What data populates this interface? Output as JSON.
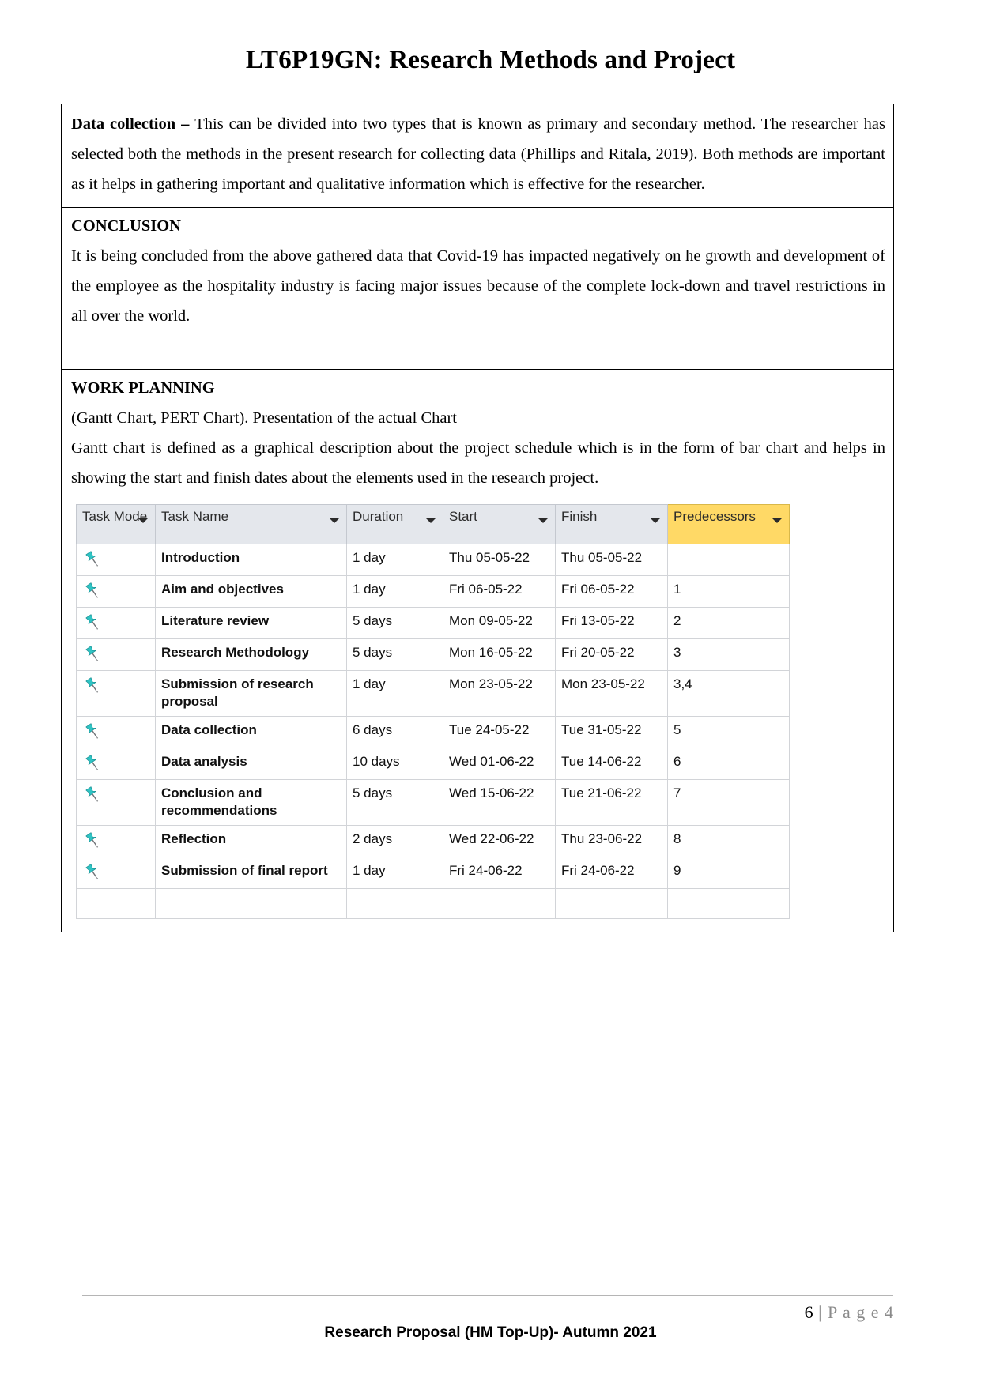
{
  "document": {
    "title": "LT6P19GN: Research Methods and Project"
  },
  "sections": {
    "data_collection": {
      "label": "Data collection – ",
      "body": "This can be divided into two types that is known as primary and secondary method. The researcher has selected both the methods in the present research for collecting data (Phillips and Ritala, 2019). Both methods are important as it helps in gathering important and qualitative information which is effective for the researcher."
    },
    "conclusion": {
      "heading": "CONCLUSION",
      "body": "It is being concluded from the above gathered data that Covid-19 has impacted negatively on he growth and development of the employee as the hospitality industry is facing major issues because of the complete lock-down and travel restrictions in all over the world."
    },
    "work_planning": {
      "heading": "WORK PLANNING",
      "line1": "(Gantt Chart, PERT Chart). Presentation of the actual Chart",
      "line2": "Gantt chart is defined as a graphical description about the project schedule which is in the form of bar chart and helps in showing the start and finish dates about the elements used in the research project."
    }
  },
  "gantt": {
    "columns": [
      {
        "key": "mode",
        "label": "Task Mode",
        "highlight": false,
        "filter": true
      },
      {
        "key": "name",
        "label": "Task Name",
        "highlight": false,
        "filter": true
      },
      {
        "key": "dur",
        "label": "Duration",
        "highlight": false,
        "filter": true
      },
      {
        "key": "start",
        "label": "Start",
        "highlight": false,
        "filter": true
      },
      {
        "key": "fin",
        "label": "Finish",
        "highlight": false,
        "filter": true
      },
      {
        "key": "pred",
        "label": "Predecessors",
        "highlight": true,
        "filter": true
      }
    ],
    "header_highlight_color": "#ffd966",
    "header_bg_color": "#e4e7ec",
    "selection_color": "#dce6f1",
    "pin_color": "#2fc4c4",
    "rows": [
      {
        "mode_icon": "pushpin-icon",
        "name": "Introduction",
        "dur": "1 day",
        "start": "Thu 05-05-22",
        "fin": "Thu 05-05-22",
        "pred": "",
        "selected": false
      },
      {
        "mode_icon": "pushpin-icon",
        "name": "Aim and objectives",
        "dur": "1 day",
        "start": "Fri 06-05-22",
        "fin": "Fri 06-05-22",
        "pred": "1",
        "selected": false
      },
      {
        "mode_icon": "pushpin-icon",
        "name": "Literature review",
        "dur": "5 days",
        "start": "Mon 09-05-22",
        "fin": "Fri 13-05-22",
        "pred": "2",
        "selected": false
      },
      {
        "mode_icon": "pushpin-icon",
        "name": "Research Methodology",
        "dur": "5 days",
        "start": "Mon 16-05-22",
        "fin": "Fri 20-05-22",
        "pred": "3",
        "selected": false
      },
      {
        "mode_icon": "pushpin-icon",
        "name": "Submission of research proposal",
        "dur": "1 day",
        "start": "Mon 23-05-22",
        "fin": "Mon 23-05-22",
        "pred": "3,4",
        "selected": false
      },
      {
        "mode_icon": "pushpin-icon",
        "name": "Data collection",
        "dur": "6 days",
        "start": "Tue 24-05-22",
        "fin": "Tue 31-05-22",
        "pred": "5",
        "selected": false
      },
      {
        "mode_icon": "pushpin-icon",
        "name": "Data analysis",
        "dur": "10 days",
        "start": "Wed 01-06-22",
        "fin": "Tue 14-06-22",
        "pred": "6",
        "selected": false
      },
      {
        "mode_icon": "pushpin-icon",
        "name": "Conclusion and recommendations",
        "dur": "5 days",
        "start": "Wed 15-06-22",
        "fin": "Tue 21-06-22",
        "pred": "7",
        "selected": false
      },
      {
        "mode_icon": "pushpin-icon",
        "name": "Reflection",
        "dur": "2 days",
        "start": "Wed 22-06-22",
        "fin": "Thu 23-06-22",
        "pred": "8",
        "selected": false
      },
      {
        "mode_icon": "pushpin-icon",
        "name": "Submission of final report",
        "dur": "1 day",
        "start": "Fri 24-06-22",
        "fin": "Fri 24-06-22",
        "pred": "9",
        "selected": true
      }
    ]
  },
  "footer": {
    "page_number": "6",
    "page_separator": "|",
    "page_word": "P a g e 4",
    "text": "Research Proposal (HM Top-Up)- Autumn 2021"
  }
}
